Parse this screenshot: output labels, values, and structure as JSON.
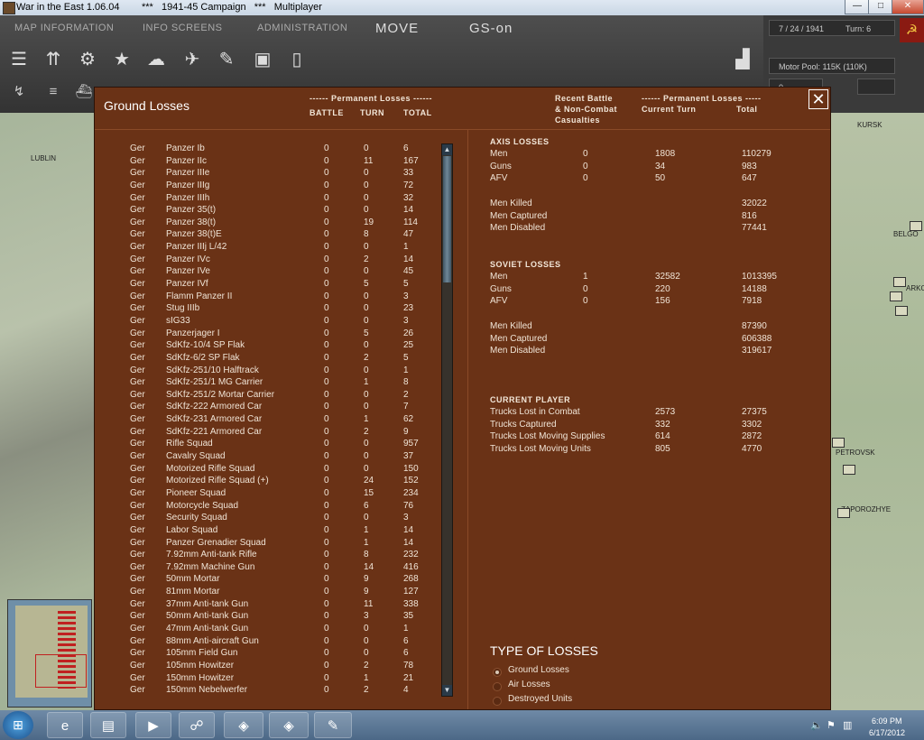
{
  "window": {
    "title": "War in the East 1.06.04        ***   1941-45 Campaign   ***   Multiplayer",
    "min": "—",
    "max": "□",
    "close": "✕"
  },
  "menu": {
    "map_information": "MAP INFORMATION",
    "info_screens": "INFO SCREENS",
    "administration": "ADMINISTRATION",
    "move": "MOVE",
    "gs_on": "GS-on"
  },
  "status": {
    "date": "7 / 24 / 1941",
    "turn": "Turn: 6",
    "motor_pool": "Motor Pool:  115K (110K)",
    "field_value": "0"
  },
  "dialog": {
    "title": "Ground Losses",
    "left_header_group": "------ Permanent Losses ------",
    "col_battle": "BATTLE",
    "col_turn": "TURN",
    "col_total": "TOTAL",
    "recent_header_1": "Recent Battle",
    "recent_header_2": "& Non-Combat",
    "recent_header_3": "Casualties",
    "right_header_group": "------ Permanent Losses -----",
    "current_turn": "Current Turn",
    "total": "Total",
    "close": "✕"
  },
  "units": [
    {
      "nat": "Ger",
      "name": "Panzer Ib",
      "battle": "0",
      "turn": "0",
      "total": "6"
    },
    {
      "nat": "Ger",
      "name": "Panzer IIc",
      "battle": "0",
      "turn": "11",
      "total": "167"
    },
    {
      "nat": "Ger",
      "name": "Panzer IIIe",
      "battle": "0",
      "turn": "0",
      "total": "33"
    },
    {
      "nat": "Ger",
      "name": "Panzer IIIg",
      "battle": "0",
      "turn": "0",
      "total": "72"
    },
    {
      "nat": "Ger",
      "name": "Panzer IIIh",
      "battle": "0",
      "turn": "0",
      "total": "32"
    },
    {
      "nat": "Ger",
      "name": "Panzer 35(t)",
      "battle": "0",
      "turn": "0",
      "total": "14"
    },
    {
      "nat": "Ger",
      "name": "Panzer 38(t)",
      "battle": "0",
      "turn": "19",
      "total": "114"
    },
    {
      "nat": "Ger",
      "name": "Panzer 38(t)E",
      "battle": "0",
      "turn": "8",
      "total": "47"
    },
    {
      "nat": "Ger",
      "name": "Panzer IIIj L/42",
      "battle": "0",
      "turn": "0",
      "total": "1"
    },
    {
      "nat": "Ger",
      "name": "Panzer IVc",
      "battle": "0",
      "turn": "2",
      "total": "14"
    },
    {
      "nat": "Ger",
      "name": "Panzer IVe",
      "battle": "0",
      "turn": "0",
      "total": "45"
    },
    {
      "nat": "Ger",
      "name": "Panzer IVf",
      "battle": "0",
      "turn": "5",
      "total": "5"
    },
    {
      "nat": "Ger",
      "name": "Flamm Panzer II",
      "battle": "0",
      "turn": "0",
      "total": "3"
    },
    {
      "nat": "Ger",
      "name": "Stug IIIb",
      "battle": "0",
      "turn": "0",
      "total": "23"
    },
    {
      "nat": "Ger",
      "name": "sIG33",
      "battle": "0",
      "turn": "0",
      "total": "3"
    },
    {
      "nat": "Ger",
      "name": "Panzerjager I",
      "battle": "0",
      "turn": "5",
      "total": "26"
    },
    {
      "nat": "Ger",
      "name": "SdKfz-10/4 SP Flak",
      "battle": "0",
      "turn": "0",
      "total": "25"
    },
    {
      "nat": "Ger",
      "name": "SdKfz-6/2 SP Flak",
      "battle": "0",
      "turn": "2",
      "total": "5"
    },
    {
      "nat": "Ger",
      "name": "SdKfz-251/10 Halftrack",
      "battle": "0",
      "turn": "0",
      "total": "1"
    },
    {
      "nat": "Ger",
      "name": "SdKfz-251/1 MG Carrier",
      "battle": "0",
      "turn": "1",
      "total": "8"
    },
    {
      "nat": "Ger",
      "name": "SdKfz-251/2 Mortar Carrier",
      "battle": "0",
      "turn": "0",
      "total": "2"
    },
    {
      "nat": "Ger",
      "name": "SdKfz-222 Armored Car",
      "battle": "0",
      "turn": "0",
      "total": "7"
    },
    {
      "nat": "Ger",
      "name": "SdKfz-231 Armored Car",
      "battle": "0",
      "turn": "1",
      "total": "62"
    },
    {
      "nat": "Ger",
      "name": "SdKfz-221 Armored Car",
      "battle": "0",
      "turn": "2",
      "total": "9"
    },
    {
      "nat": "Ger",
      "name": "Rifle Squad",
      "battle": "0",
      "turn": "0",
      "total": "957"
    },
    {
      "nat": "Ger",
      "name": "Cavalry Squad",
      "battle": "0",
      "turn": "0",
      "total": "37"
    },
    {
      "nat": "Ger",
      "name": "Motorized Rifle Squad",
      "battle": "0",
      "turn": "0",
      "total": "150"
    },
    {
      "nat": "Ger",
      "name": "Motorized Rifle Squad (+)",
      "battle": "0",
      "turn": "24",
      "total": "152"
    },
    {
      "nat": "Ger",
      "name": "Pioneer Squad",
      "battle": "0",
      "turn": "15",
      "total": "234"
    },
    {
      "nat": "Ger",
      "name": "Motorcycle Squad",
      "battle": "0",
      "turn": "6",
      "total": "76"
    },
    {
      "nat": "Ger",
      "name": "Security Squad",
      "battle": "0",
      "turn": "0",
      "total": "3"
    },
    {
      "nat": "Ger",
      "name": "Labor Squad",
      "battle": "0",
      "turn": "1",
      "total": "14"
    },
    {
      "nat": "Ger",
      "name": "Panzer Grenadier Squad",
      "battle": "0",
      "turn": "1",
      "total": "14"
    },
    {
      "nat": "Ger",
      "name": "7.92mm Anti-tank Rifle",
      "battle": "0",
      "turn": "8",
      "total": "232"
    },
    {
      "nat": "Ger",
      "name": "7.92mm Machine Gun",
      "battle": "0",
      "turn": "14",
      "total": "416"
    },
    {
      "nat": "Ger",
      "name": "50mm Mortar",
      "battle": "0",
      "turn": "9",
      "total": "268"
    },
    {
      "nat": "Ger",
      "name": "81mm Mortar",
      "battle": "0",
      "turn": "9",
      "total": "127"
    },
    {
      "nat": "Ger",
      "name": "37mm Anti-tank Gun",
      "battle": "0",
      "turn": "11",
      "total": "338"
    },
    {
      "nat": "Ger",
      "name": "50mm Anti-tank Gun",
      "battle": "0",
      "turn": "3",
      "total": "35"
    },
    {
      "nat": "Ger",
      "name": "47mm Anti-tank Gun",
      "battle": "0",
      "turn": "0",
      "total": "1"
    },
    {
      "nat": "Ger",
      "name": "88mm Anti-aircraft Gun",
      "battle": "0",
      "turn": "0",
      "total": "6"
    },
    {
      "nat": "Ger",
      "name": "105mm Field Gun",
      "battle": "0",
      "turn": "0",
      "total": "6"
    },
    {
      "nat": "Ger",
      "name": "105mm Howitzer",
      "battle": "0",
      "turn": "2",
      "total": "78"
    },
    {
      "nat": "Ger",
      "name": "150mm Howitzer",
      "battle": "0",
      "turn": "1",
      "total": "21"
    },
    {
      "nat": "Ger",
      "name": "150mm Nebelwerfer",
      "battle": "0",
      "turn": "2",
      "total": "4"
    }
  ],
  "axis": {
    "title": "AXIS LOSSES",
    "rows": [
      {
        "label": "Men",
        "recent": "0",
        "turn": "1808",
        "total": "110279"
      },
      {
        "label": "Guns",
        "recent": "0",
        "turn": "34",
        "total": "983"
      },
      {
        "label": "AFV",
        "recent": "0",
        "turn": "50",
        "total": "647"
      }
    ],
    "killed": {
      "label": "Men Killed",
      "total": "32022"
    },
    "captured": {
      "label": "Men Captured",
      "total": "816"
    },
    "disabled": {
      "label": "Men Disabled",
      "total": "77441"
    }
  },
  "soviet": {
    "title": "SOVIET LOSSES",
    "rows": [
      {
        "label": "Men",
        "recent": "1",
        "turn": "32582",
        "total": "1013395"
      },
      {
        "label": "Guns",
        "recent": "0",
        "turn": "220",
        "total": "14188"
      },
      {
        "label": "AFV",
        "recent": "0",
        "turn": "156",
        "total": "7918"
      }
    ],
    "killed": {
      "label": "Men Killed",
      "total": "87390"
    },
    "captured": {
      "label": "Men Captured",
      "total": "606388"
    },
    "disabled": {
      "label": "Men Disabled",
      "total": "319617"
    }
  },
  "current_player": {
    "title": "CURRENT PLAYER",
    "rows": [
      {
        "label": "Trucks Lost in Combat",
        "turn": "2573",
        "total": "27375"
      },
      {
        "label": "Trucks Captured",
        "turn": "332",
        "total": "3302"
      },
      {
        "label": "Trucks Lost Moving Supplies",
        "turn": "614",
        "total": "2872"
      },
      {
        "label": "Trucks Lost Moving Units",
        "turn": "805",
        "total": "4770"
      }
    ]
  },
  "types": {
    "title": "TYPE OF LOSSES",
    "options": [
      "Ground Losses",
      "Air Losses",
      "Destroyed Units"
    ],
    "selected": "Ground Losses"
  },
  "map_labels": {
    "lublin": "LUBLIN",
    "kursk": "KURSK",
    "belgo": "BELGO",
    "ark": "ARKO",
    "petrovsk": "PETROVSK",
    "zaporozhye": "ZAPOROZHYE"
  },
  "tray": {
    "time": "6:09 PM",
    "date": "6/17/2012"
  },
  "colors": {
    "dialog_bg": "#6a3216",
    "text": "#f0e4d6"
  }
}
